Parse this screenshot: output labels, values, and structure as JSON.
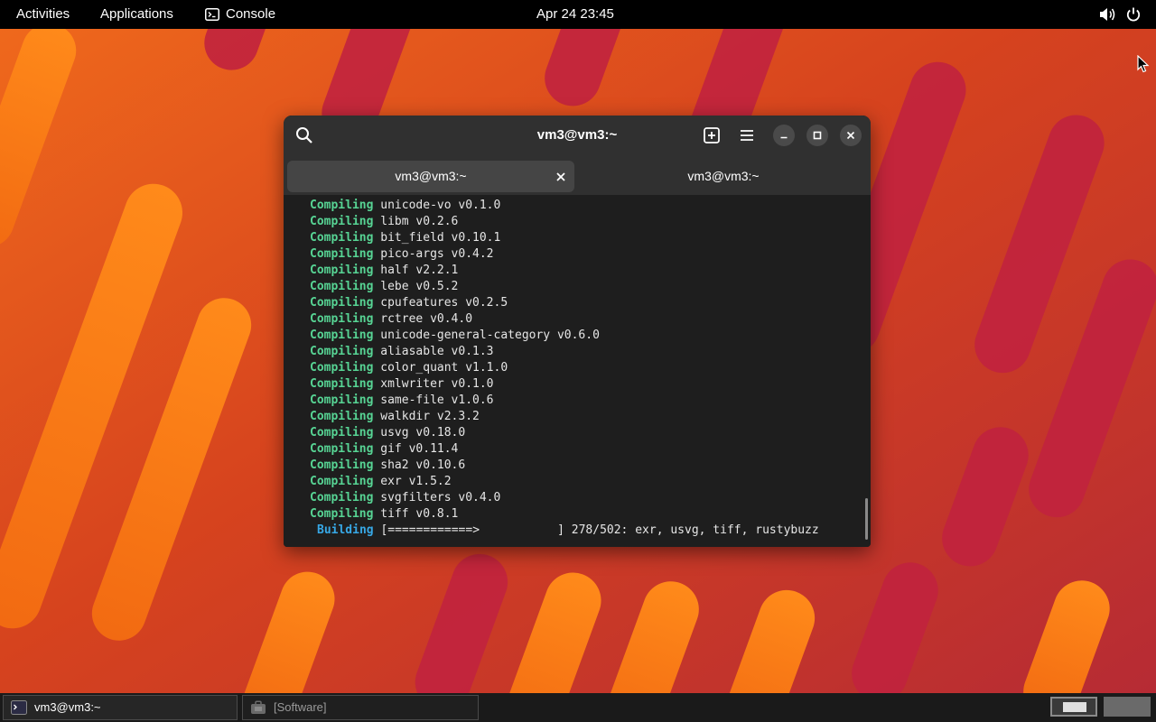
{
  "topbar": {
    "activities": "Activities",
    "applications": "Applications",
    "console": "Console",
    "clock": "Apr 24  23:45",
    "icons": [
      "console-icon",
      "volume-icon",
      "power-icon"
    ]
  },
  "window": {
    "title": "vm3@vm3:~",
    "icons": [
      "search-icon",
      "new-tab-icon",
      "hamburger-menu-icon",
      "minimize-icon",
      "maximize-icon",
      "close-icon"
    ],
    "tabs": [
      {
        "label": "vm3@vm3:~",
        "active": true
      },
      {
        "label": "vm3@vm3:~",
        "active": false
      }
    ]
  },
  "terminal": {
    "lines": [
      {
        "keyword": "Compiling",
        "text": " unicode-vo v0.1.0"
      },
      {
        "keyword": "Compiling",
        "text": " libm v0.2.6"
      },
      {
        "keyword": "Compiling",
        "text": " bit_field v0.10.1"
      },
      {
        "keyword": "Compiling",
        "text": " pico-args v0.4.2"
      },
      {
        "keyword": "Compiling",
        "text": " half v2.2.1"
      },
      {
        "keyword": "Compiling",
        "text": " lebe v0.5.2"
      },
      {
        "keyword": "Compiling",
        "text": " cpufeatures v0.2.5"
      },
      {
        "keyword": "Compiling",
        "text": " rctree v0.4.0"
      },
      {
        "keyword": "Compiling",
        "text": " unicode-general-category v0.6.0"
      },
      {
        "keyword": "Compiling",
        "text": " aliasable v0.1.3"
      },
      {
        "keyword": "Compiling",
        "text": " color_quant v1.1.0"
      },
      {
        "keyword": "Compiling",
        "text": " xmlwriter v0.1.0"
      },
      {
        "keyword": "Compiling",
        "text": " same-file v1.0.6"
      },
      {
        "keyword": "Compiling",
        "text": " walkdir v2.3.2"
      },
      {
        "keyword": "Compiling",
        "text": " usvg v0.18.0"
      },
      {
        "keyword": "Compiling",
        "text": " gif v0.11.4"
      },
      {
        "keyword": "Compiling",
        "text": " sha2 v0.10.6"
      },
      {
        "keyword": "Compiling",
        "text": " exr v1.5.2"
      },
      {
        "keyword": "Compiling",
        "text": " svgfilters v0.4.0"
      },
      {
        "keyword": "Compiling",
        "text": " tiff v0.8.1"
      },
      {
        "keyword": "Building",
        "text": " [============>           ] 278/502: exr, usvg, tiff, rustybuzz"
      }
    ],
    "colors": {
      "compiling": "#57d494",
      "building": "#37a8e6",
      "background": "#1e1e1e"
    }
  },
  "taskbar": {
    "tasks": [
      {
        "label": "vm3@vm3:~",
        "icon": "terminal-icon",
        "active": true
      },
      {
        "label": "[Software]",
        "icon": "software-icon",
        "active": false
      }
    ],
    "workspaces": 2
  }
}
